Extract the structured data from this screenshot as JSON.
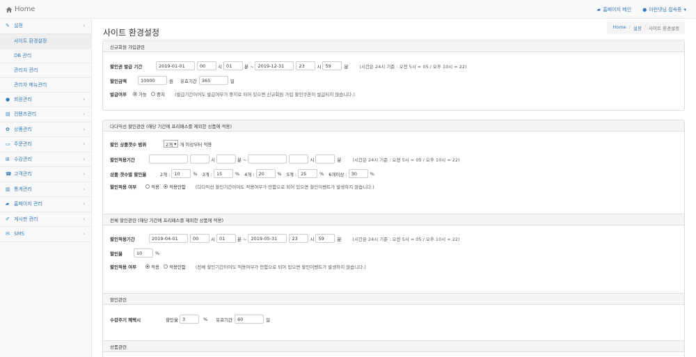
{
  "nav": {
    "brand": "Home",
    "home_link": "홈페이지 메인",
    "user_menu": "이런넷님 접속중",
    "sidebar": [
      {
        "label": "설정",
        "icon": "wrench-icon",
        "glyph": "✎"
      },
      {
        "label": "사이트 환경설정",
        "sub": true,
        "active": true
      },
      {
        "label": "DB 관리",
        "sub": true
      },
      {
        "label": "관리자 관리",
        "sub": true
      },
      {
        "label": "관리자 메뉴관리",
        "sub": true
      },
      {
        "label": "회원관리",
        "icon": "user-icon",
        "glyph": "●"
      },
      {
        "label": "컨텐츠관리",
        "icon": "film-icon",
        "glyph": "▤"
      },
      {
        "label": "상품관리",
        "icon": "gift-icon",
        "glyph": "✿"
      },
      {
        "label": "주문관리",
        "icon": "folder-icon",
        "glyph": "▭"
      },
      {
        "label": "수강관리",
        "icon": "cart-icon",
        "glyph": "⊞"
      },
      {
        "label": "고객관리",
        "icon": "phone-icon",
        "glyph": "☎"
      },
      {
        "label": "통계관리",
        "icon": "chart-icon",
        "glyph": "▥"
      },
      {
        "label": "홈페이지 관리",
        "icon": "car-icon",
        "glyph": "▰"
      },
      {
        "label": "게시판 관리",
        "icon": "edit-icon",
        "glyph": "✐"
      },
      {
        "label": "SMS",
        "icon": "envelope-icon",
        "glyph": "✉"
      }
    ]
  },
  "page": {
    "title": "사이트 환경설정",
    "breadcrumb": [
      "Home",
      "설정",
      "사이트 환경설정"
    ]
  },
  "p1": {
    "heading": "신규회원 가입관련",
    "issue_label": "할인권 발급 기간",
    "start_date": "2019-01-01",
    "start_hour": "00",
    "start_min": "01",
    "end_date": "2019-12-31",
    "end_hour": "23",
    "end_min": "59",
    "hour_unit": "시",
    "min_unit": "분",
    "min_unit_tilde": "분 ~",
    "time_note": "(시간은 24시 기준 : 오전 5시 = 05 / 오후 10시 = 22)",
    "amount_label": "할인금액",
    "amount": "10000",
    "amount_unit": "원",
    "valid_label": "유효기간",
    "valid_days": "365",
    "valid_unit": "일",
    "issue_yn_label": "발급여부",
    "opt_yes": "가능",
    "opt_no": "중지",
    "issue_note": "(발급기간이어도 발급여부가 중지로 되어 있으면 신규회원 가입 할인쿠폰이 발급되지 않습니다.)"
  },
  "p2": {
    "heading": "다다익선 할인관련 (해당 기간에 프리패스를 제외한 상품에 적용)",
    "range_label": "할인 상품갯수 범위",
    "range_value": "2개",
    "range_suffix": "개 이상부터 적용",
    "period_label": "할인적용기간",
    "hour_unit": "시",
    "min_unit": "분",
    "min_unit_tilde": "분 ~",
    "time_note": "(시간은 24시 기준 : 오전 5시 = 05 / 오후 10시 = 22)",
    "rate_label": "상품 갯수별 할인율",
    "rates": [
      {
        "label": "2개 :",
        "value": "10"
      },
      {
        "label": "3개 :",
        "value": "15"
      },
      {
        "label": "4개 :",
        "value": "20"
      },
      {
        "label": "5개 :",
        "value": "25"
      },
      {
        "label": "6개이상 :",
        "value": "30"
      }
    ],
    "pct": "%",
    "apply_label": "할인적용 여부",
    "opt_apply": "적용",
    "opt_noapply": "적용안함",
    "apply_note": "(다다익선 할인기간이어도 적용여부가 안함으로 되어 있으면 할인이벤트가 발생하지 않습니다.)"
  },
  "p3": {
    "heading": "전체 할인관련 (해당 기간에 프리패스를 제외한 상품에 적용)",
    "period_label": "할인적용기간",
    "start_date": "2019-04-01",
    "start_hour": "00",
    "start_min": "01",
    "end_date": "2019-05-31",
    "end_hour": "23",
    "end_min": "59",
    "hour_unit": "시",
    "min_unit": "분",
    "min_unit_tilde": "분 ~",
    "time_note": "(시간은 24시 기준 : 오전 5시 = 05 / 오후 10시 = 22)",
    "rate_label": "할인율",
    "rate": "10",
    "pct": "%",
    "apply_label": "할인적용 여부",
    "opt_apply": "적용",
    "opt_noapply": "적용안함",
    "apply_note": "(전체 할인기간이어도 적용여부가 안함으로 되어 있으면 할인이벤트가 발생하지 않습니다.)"
  },
  "p4": {
    "heading": "할인관련",
    "label": "수강주기 혜택시",
    "rate_label": "할인율",
    "rate": "3",
    "pct": "%",
    "valid_label": "유효기간",
    "valid_days": "60",
    "valid_unit": "일"
  },
  "p5": {
    "heading": "상품관련"
  }
}
